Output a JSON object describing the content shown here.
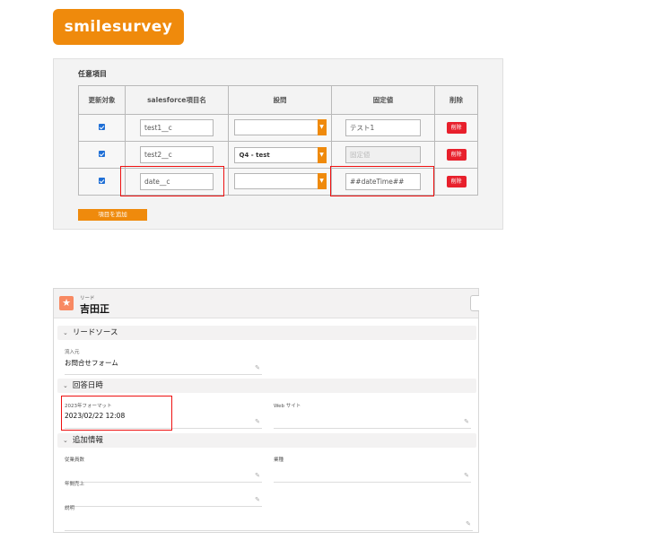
{
  "logo": {
    "text": "smilesurvey",
    "color": "#ef8a0c"
  },
  "optional_items": {
    "title": "任意項目",
    "headers": {
      "update": "更新対象",
      "name": "salesforce項目名",
      "question": "設問",
      "fixed": "固定値",
      "delete": "削除"
    },
    "rows": [
      {
        "checked": true,
        "field_name": "test1__c",
        "question": "",
        "fixed_value": "テスト1",
        "fixed_placeholder": "",
        "delete_label": "削除"
      },
      {
        "checked": true,
        "field_name": "test2__c",
        "question": "Q4 - test",
        "fixed_value": "",
        "fixed_placeholder": "固定値",
        "delete_label": "削除"
      },
      {
        "checked": true,
        "field_name": "date__c",
        "question": "",
        "fixed_value": "##dateTime##",
        "fixed_placeholder": "",
        "delete_label": "削除"
      }
    ],
    "add_button": "項目を追加",
    "highlight_color": "#e11111",
    "delete_color": "#e8202c"
  },
  "lead": {
    "object_label": "リード",
    "name": "吉田正",
    "sections": {
      "lead_source": "リードソース",
      "response_datetime": "回答日時",
      "additional_info": "追加情報"
    },
    "fields": {
      "source_label": "流入元",
      "source_value": "お問合せフォーム",
      "format_label": "2023年フォーマット",
      "format_value": "2023/02/22 12:08",
      "website_label": "Web サイト",
      "employees_label": "従業員数",
      "industry_label": "業種",
      "annual_revenue_label": "年間売上",
      "description_label": "説明"
    }
  }
}
